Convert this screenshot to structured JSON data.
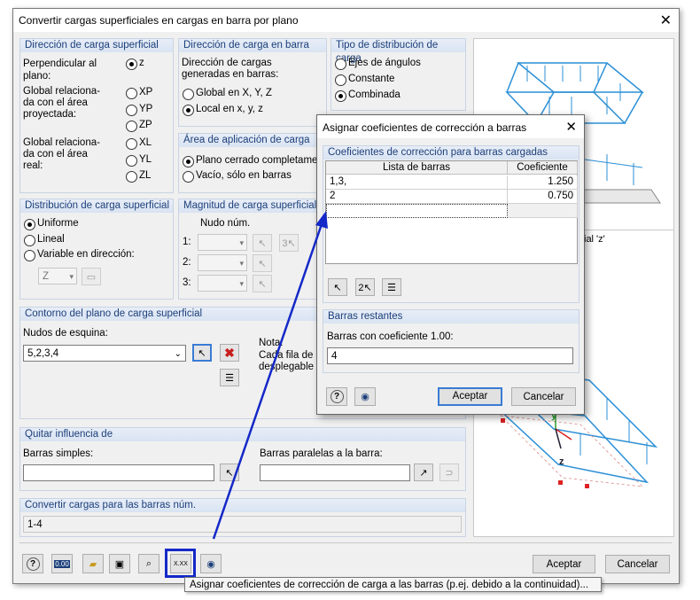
{
  "window": {
    "title": "Convertir cargas superficiales en cargas en barra por plano",
    "close": "✕"
  },
  "dir_surface": {
    "header": "Dirección de carga superficial",
    "perp_label": "Perpendicular al plano:",
    "perp_opt": "z",
    "proj_label": "Global relaciona-da con el área proyectada:",
    "proj_opts": [
      "XP",
      "YP",
      "ZP"
    ],
    "real_label": "Global relaciona-da con el área real:",
    "real_opts": [
      "XL",
      "YL",
      "ZL"
    ]
  },
  "dir_member": {
    "header": "Dirección de carga en barra",
    "text": "Dirección de cargas generadas en barras:",
    "opt_global": "Global en X, Y, Z",
    "opt_local": "Local en x, y, z"
  },
  "dist_type": {
    "header": "Tipo de distribución de carga",
    "opts": [
      "Ejes de ángulos",
      "Constante",
      "Combinada"
    ]
  },
  "area_app": {
    "header": "Área de aplicación de carga",
    "opt_closed": "Plano cerrado completament",
    "opt_empty": "Vacío, sólo en barras"
  },
  "dist_surface": {
    "header": "Distribución de carga superficial",
    "opts": [
      "Uniforme",
      "Lineal",
      "Variable en dirección:"
    ],
    "dir_value": "Z"
  },
  "magnitude": {
    "header": "Magnitud de carga superficial",
    "node_label": "Nudo núm.",
    "rows": [
      "1:",
      "2:",
      "3:"
    ]
  },
  "contour": {
    "header": "Contorno del plano de carga superficial",
    "corner_label": "Nudos de esquina:",
    "corner_value": "5,2,3,4",
    "note_label": "Nota:",
    "note_text_1": "Cada fila de la",
    "note_text_2": "desplegable in"
  },
  "remove": {
    "header": "Quitar influencia de",
    "simple_label": "Barras simples:",
    "parallel_label": "Barras paralelas a la barra:"
  },
  "convert": {
    "header": "Convertir cargas para las barras núm.",
    "value": "1-4"
  },
  "diagram": {
    "label": "ficial 'z'",
    "axis_y": "y",
    "axis_z": "z"
  },
  "subdialog": {
    "title": "Asignar coeficientes de corrección a barras",
    "close": "✕",
    "group_header": "Coeficientes de corrección para barras cargadas",
    "col_members": "Lista de barras",
    "col_coef": "Coeficiente",
    "rows": [
      {
        "members": "1,3,",
        "coef": "1.250"
      },
      {
        "members": "2",
        "coef": "0.750"
      }
    ],
    "rest_header": "Barras restantes",
    "rest_label": "Barras con coeficiente 1.00:",
    "rest_value": "4",
    "ok": "Aceptar",
    "cancel": "Cancelar"
  },
  "footer": {
    "ok": "Aceptar",
    "cancel": "Cancelar",
    "units_icon": "0.00",
    "xxx_icon": "X.XX"
  },
  "tooltip": "Asignar coeficientes de corrección de carga a las barras (p.ej. debido a la continuidad)...",
  "colors": {
    "accent": "#1428c8",
    "load": "#2b8fd6",
    "group_header": "#1c3f7a"
  }
}
